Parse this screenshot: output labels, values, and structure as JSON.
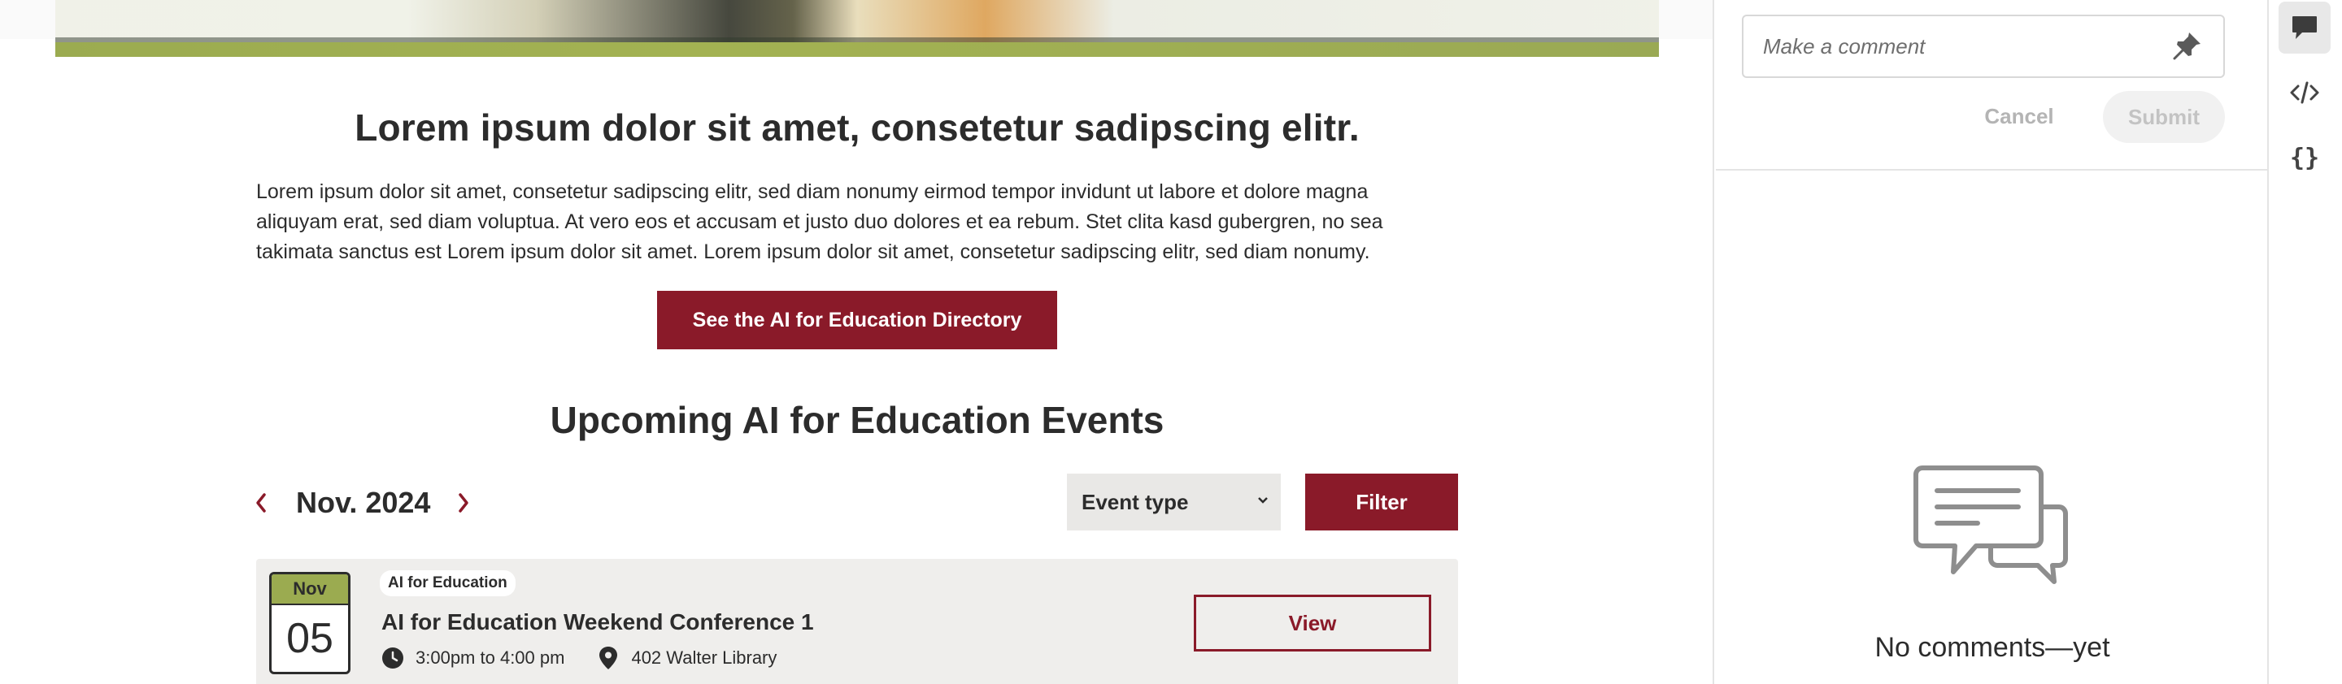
{
  "page": {
    "heading": "Lorem ipsum dolor sit amet, consetetur sadipscing elitr.",
    "intro": "Lorem ipsum dolor sit amet, consetetur sadipscing elitr, sed diam nonumy eirmod tempor invidunt ut labore et dolore magna aliquyam erat, sed diam voluptua. At vero eos et accusam et justo duo dolores et ea rebum. Stet clita kasd gubergren, no sea takimata sanctus est Lorem ipsum dolor sit amet. Lorem ipsum dolor sit amet, consetetur sadipscing elitr, sed diam nonumy.",
    "directory_button": "See the AI for Education Directory"
  },
  "events": {
    "heading": "Upcoming AI for Education Events",
    "month_label": "Nov. 2024",
    "event_type_label": "Event type",
    "filter_label": "Filter",
    "items": [
      {
        "month": "Nov",
        "day": "05",
        "tag": "AI for Education",
        "title": "AI for Education Weekend Conference 1",
        "time": "3:00pm to 4:00 pm",
        "location": "402 Walter Library",
        "view_label": "View"
      }
    ]
  },
  "comments": {
    "placeholder": "Make a comment",
    "cancel_label": "Cancel",
    "submit_label": "Submit",
    "empty_label": "No comments—yet"
  },
  "rail": {
    "json_label": "{}"
  },
  "colors": {
    "brand_maroon": "#8a1a29",
    "accent_green": "#9bab50"
  }
}
